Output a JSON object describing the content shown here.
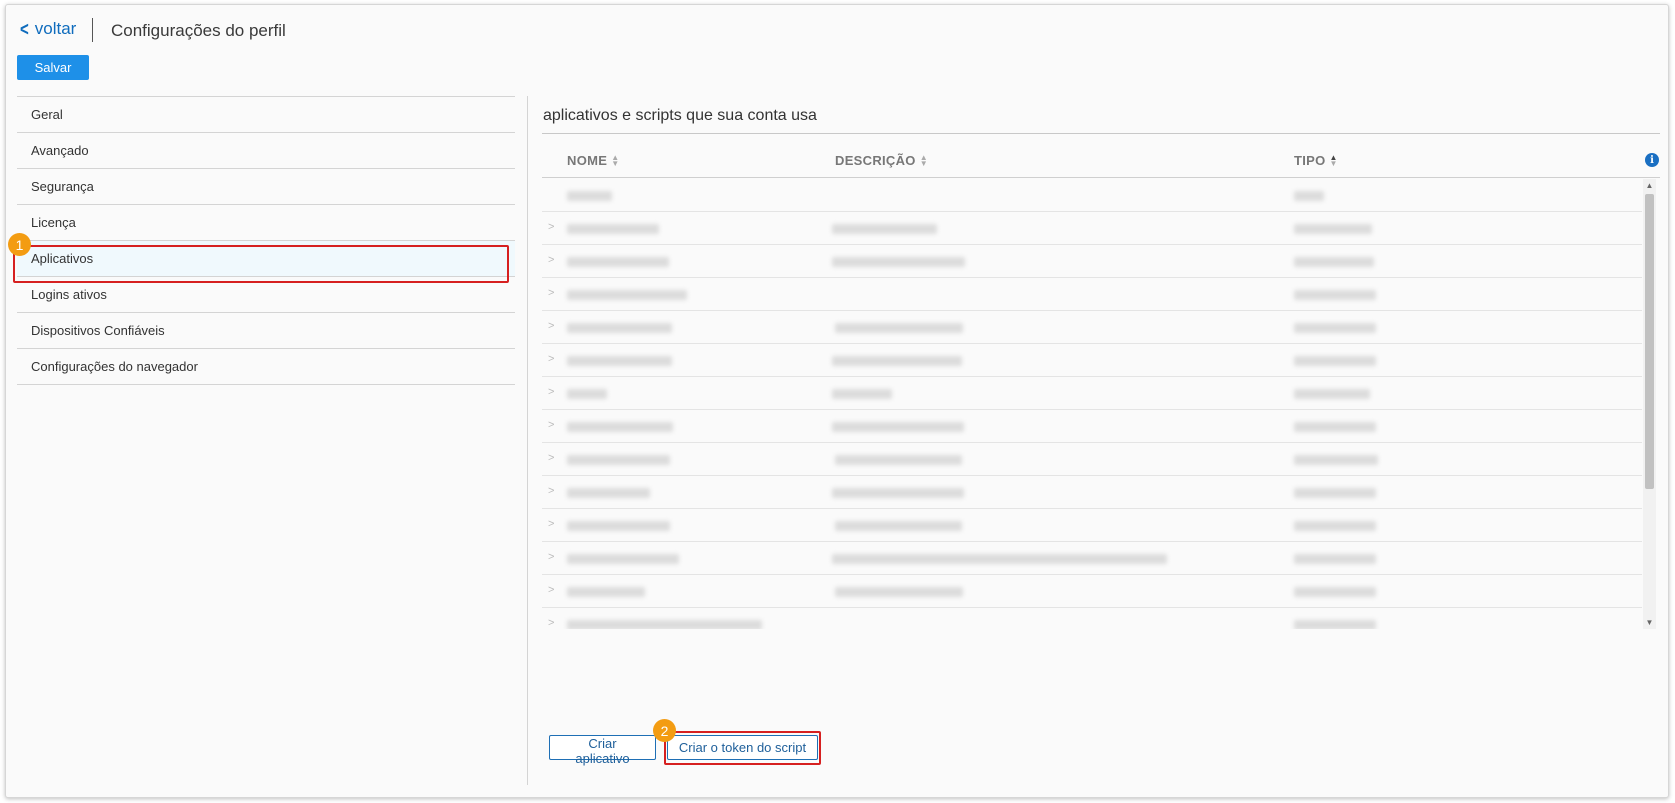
{
  "header": {
    "back_label": "voltar",
    "title": "Configurações do perfil",
    "save_label": "Salvar"
  },
  "sidebar": {
    "items": [
      {
        "label": "Geral"
      },
      {
        "label": "Avançado"
      },
      {
        "label": "Segurança"
      },
      {
        "label": "Licença"
      },
      {
        "label": "Aplicativos",
        "active": true
      },
      {
        "label": "Logins ativos"
      },
      {
        "label": "Dispositivos Confiáveis"
      },
      {
        "label": "Configurações do navegador"
      }
    ]
  },
  "main": {
    "title": "aplicativos e scripts que sua conta usa",
    "columns": {
      "name": "NOME",
      "description": "DESCRIÇÃO",
      "type": "TIPO"
    },
    "sorted_column": "TIPO",
    "row_count_visible": 14,
    "rows_content": "redacted (blurred)"
  },
  "actions": {
    "create_app_label": "Criar aplicativo",
    "create_token_label": "Criar o token do script"
  },
  "callouts": [
    "1",
    "2"
  ],
  "colors": {
    "accent": "#1e90e8",
    "link": "#0f6cbd",
    "highlight": "#d62020",
    "badge": "#f39c12"
  }
}
